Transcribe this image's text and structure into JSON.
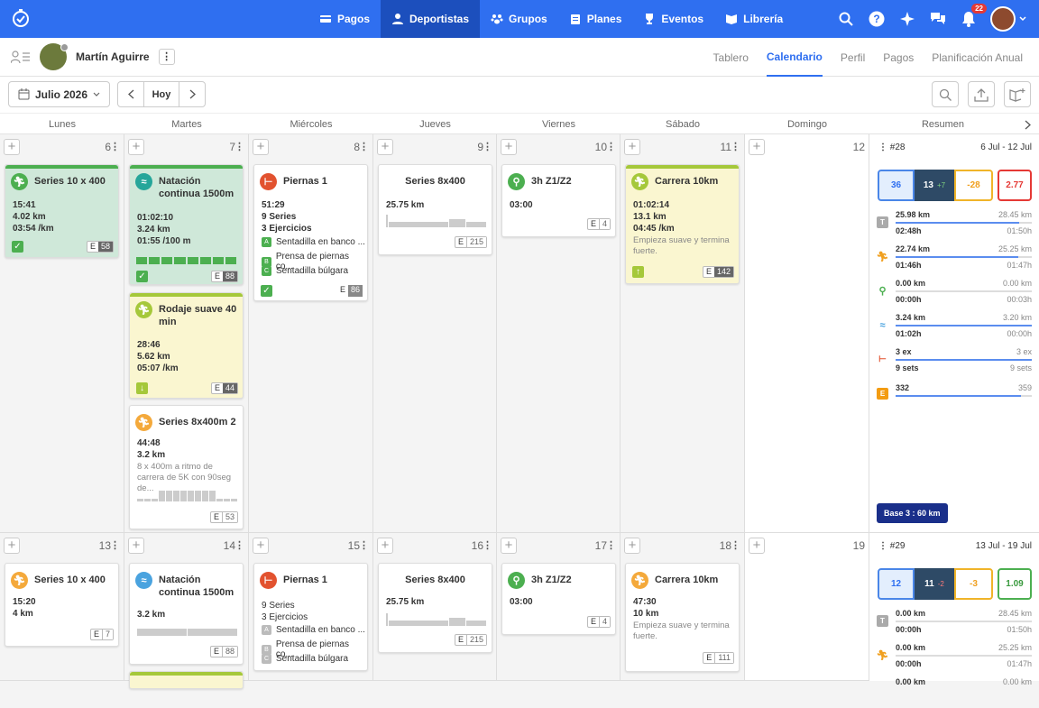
{
  "nav": {
    "items": [
      {
        "label": "Pagos"
      },
      {
        "label": "Deportistas"
      },
      {
        "label": "Grupos"
      },
      {
        "label": "Planes"
      },
      {
        "label": "Eventos"
      },
      {
        "label": "Librería"
      }
    ],
    "notif_count": "22"
  },
  "athlete": {
    "name": "Martín Aguirre",
    "kebab": "⋮"
  },
  "tabs": [
    "Tablero",
    "Calendario",
    "Perfil",
    "Pagos",
    "Planificación Anual"
  ],
  "toolbar": {
    "month": "Julio 2026",
    "today": "Hoy"
  },
  "days": [
    "Lunes",
    "Martes",
    "Miércoles",
    "Jueves",
    "Viernes",
    "Sábado",
    "Domingo",
    "Resumen"
  ],
  "week1": {
    "numbers": [
      "6",
      "7",
      "8",
      "9",
      "10",
      "11",
      "12"
    ],
    "cards": {
      "mon": {
        "title": "Series 10 x 400",
        "l1": "15:41",
        "l2": "4.02 km",
        "l3": "03:54 /km",
        "e": "E",
        "ev": "58"
      },
      "tue1": {
        "title": "Natación continua 1500m",
        "l1": "01:02:10",
        "l2": "3.24 km",
        "l3": "01:55 /100 m",
        "e": "E",
        "ev": "88"
      },
      "tue2": {
        "title": "Rodaje suave 40 min",
        "l1": "28:46",
        "l2": "5.62 km",
        "l3": "05:07 /km",
        "e": "E",
        "ev": "44"
      },
      "tue3": {
        "title": "Series 8x400m 2",
        "l1": "44:48",
        "l2": "3.2 km",
        "desc": "8 x 400m a ritmo de carrera de 5K con 90seg de...",
        "e": "E",
        "ev": "53"
      },
      "wed": {
        "title": "Piernas 1",
        "l1": "51:29",
        "l2": "9 Series",
        "l3": "3 Ejercicios",
        "ex": [
          {
            "k": "A",
            "n": "Sentadilla en banco ..."
          },
          {
            "k": "B",
            "n": "Prensa de piernas co..."
          },
          {
            "k": "C",
            "n": "Sentadilla búlgara"
          }
        ],
        "e": "E",
        "ev": "86"
      },
      "thu": {
        "title": "Series 8x400",
        "l1": "25.75 km",
        "e": "E",
        "ev": "215"
      },
      "fri": {
        "title": "3h Z1/Z2",
        "l1": "03:00",
        "e": "E",
        "ev": "4"
      },
      "sat": {
        "title": "Carrera 10km",
        "l1": "01:02:14",
        "l2": "13.1 km",
        "l3": "04:45 /km",
        "desc": "Empieza suave y termina fuerte.",
        "e": "E",
        "ev": "142"
      }
    },
    "summary": {
      "week": "#28",
      "range": "6 Jul - 12 Jul",
      "b1": "36",
      "b2": "13",
      "b2d": "+7",
      "b3": "-28",
      "b4": "2.77",
      "rows": [
        {
          "icon": "T",
          "a": "25.98 km",
          "a2": "28.45 km",
          "b": "02:48h",
          "b2": "01:50h"
        },
        {
          "a": "22.74 km",
          "a2": "25.25 km",
          "b": "01:46h",
          "b2": "01:47h"
        },
        {
          "a": "0.00 km",
          "a2": "0.00 km",
          "b": "00:00h",
          "b2": "00:03h"
        },
        {
          "a": "3.24 km",
          "a2": "3.20 km",
          "b": "01:02h",
          "b2": "00:00h"
        },
        {
          "a": "3 ex",
          "a2": "3 ex",
          "b": "9 sets",
          "b2": "9 sets"
        },
        {
          "icon": "E",
          "a": "332",
          "a2": "359"
        }
      ],
      "base": "Base 3 : 60 km"
    }
  },
  "week2": {
    "numbers": [
      "13",
      "14",
      "15",
      "16",
      "17",
      "18",
      "19"
    ],
    "cards": {
      "mon": {
        "title": "Series 10 x 400",
        "l1": "15:20",
        "l2": "4 km",
        "e": "E",
        "ev": "7"
      },
      "tue1": {
        "title": "Natación continua 1500m",
        "l1": "3.2 km",
        "e": "E",
        "ev": "88"
      },
      "wed": {
        "title": "Piernas 1",
        "l1": "9 Series",
        "l2": "3 Ejercicios",
        "ex": [
          {
            "k": "A",
            "n": "Sentadilla en banco ..."
          },
          {
            "k": "B",
            "n": "Prensa de piernas co..."
          },
          {
            "k": "C",
            "n": "Sentadilla búlgara"
          }
        ]
      },
      "thu": {
        "title": "Series 8x400",
        "l1": "25.75 km",
        "e": "E",
        "ev": "215"
      },
      "fri": {
        "title": "3h Z1/Z2",
        "l1": "03:00",
        "e": "E",
        "ev": "4"
      },
      "sat": {
        "title": "Carrera 10km",
        "l1": "47:30",
        "l2": "10 km",
        "desc": "Empieza suave y termina fuerte.",
        "e": "E",
        "ev": "111"
      }
    },
    "summary": {
      "week": "#29",
      "range": "13 Jul - 19 Jul",
      "b1": "12",
      "b2": "11",
      "b2d": "-2",
      "b3": "-3",
      "b4": "1.09",
      "rows": [
        {
          "icon": "T",
          "a": "0.00 km",
          "a2": "28.45 km",
          "b": "00:00h",
          "b2": "01:50h"
        },
        {
          "a": "0.00 km",
          "a2": "25.25 km",
          "b": "00:00h",
          "b2": "01:47h"
        },
        {
          "a": "0.00 km",
          "a2": "0.00 km"
        }
      ]
    }
  }
}
